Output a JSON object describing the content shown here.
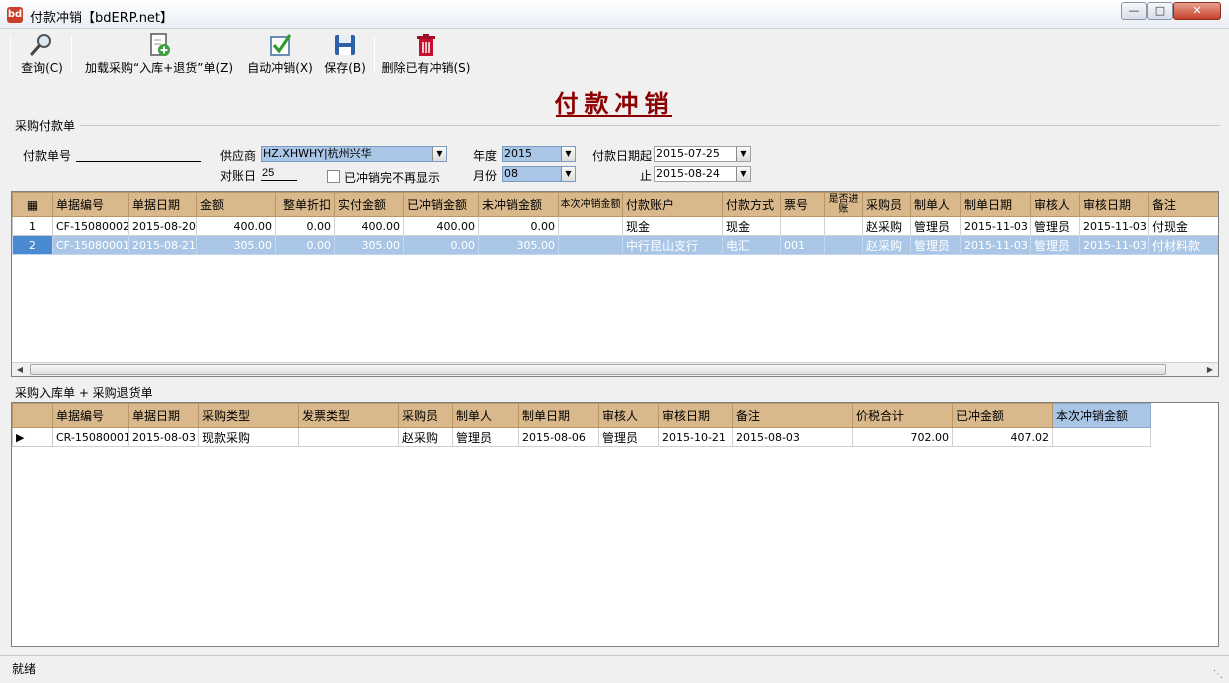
{
  "window": {
    "title": "付款冲销【bdERP.net】",
    "app_icon": "bd"
  },
  "toolbar": {
    "query": "查询(C)",
    "load": "加载采购“入库+退货”单(Z)",
    "auto": "自动冲销(X)",
    "save": "保存(B)",
    "delete": "删除已有冲销(S)"
  },
  "heading": "付款冲销",
  "payment_group": "采购付款单",
  "filters": {
    "doc_no_label": "付款单号",
    "doc_no_value": "",
    "supplier_label": "供应商",
    "supplier_value": "HZ.XHWHY|杭州兴华",
    "recon_day_label": "对账日",
    "recon_day_value": "25",
    "hide_label": "已冲销完不再显示",
    "year_label": "年度",
    "year_value": "2015",
    "month_label": "月份",
    "month_value": "08",
    "date_from_label": "付款日期起",
    "date_from_value": "2015-07-25",
    "date_to_label": "止",
    "date_to_value": "2015-08-24"
  },
  "payment_grid": {
    "headers": [
      "单据编号",
      "单据日期",
      "金额",
      "整单折扣",
      "实付金额",
      "已冲销金额",
      "未冲销金额",
      "本次冲销金额",
      "付款账户",
      "付款方式",
      "票号",
      "是否进账",
      "采购员",
      "制单人",
      "制单日期",
      "审核人",
      "审核日期",
      "备注"
    ],
    "rows": [
      {
        "n": "1",
        "c": [
          "CF-15080002",
          "2015-08-20",
          "400.00",
          "0.00",
          "400.00",
          "400.00",
          "0.00",
          "",
          "现金",
          "现金",
          "",
          "",
          "赵采购",
          "管理员",
          "2015-11-03",
          "管理员",
          "2015-11-03",
          "付现金"
        ]
      },
      {
        "n": "2",
        "c": [
          "CF-15080001",
          "2015-08-21",
          "305.00",
          "0.00",
          "305.00",
          "0.00",
          "305.00",
          "",
          "中行昆山支行",
          "电汇",
          "001",
          "",
          "赵采购",
          "管理员",
          "2015-11-03",
          "管理员",
          "2015-11-03",
          "付材料款"
        ]
      }
    ]
  },
  "receipt_group": "采购入库单 + 采购退货单",
  "receipt_grid": {
    "headers": [
      "单据编号",
      "单据日期",
      "采购类型",
      "发票类型",
      "采购员",
      "制单人",
      "制单日期",
      "审核人",
      "审核日期",
      "备注",
      "价税合计",
      "已冲金额",
      "本次冲销金额"
    ],
    "rows": [
      {
        "n": "▶",
        "c": [
          "CR-15080001",
          "2015-08-03",
          "现款采购",
          "",
          "赵采购",
          "管理员",
          "2015-08-06",
          "管理员",
          "2015-10-21",
          "2015-08-03",
          "702.00",
          "407.02",
          ""
        ]
      }
    ]
  },
  "status": "就绪",
  "colors": {
    "header": "#d9b98c",
    "selection": "#aac6e6",
    "title": "#8b0000"
  }
}
